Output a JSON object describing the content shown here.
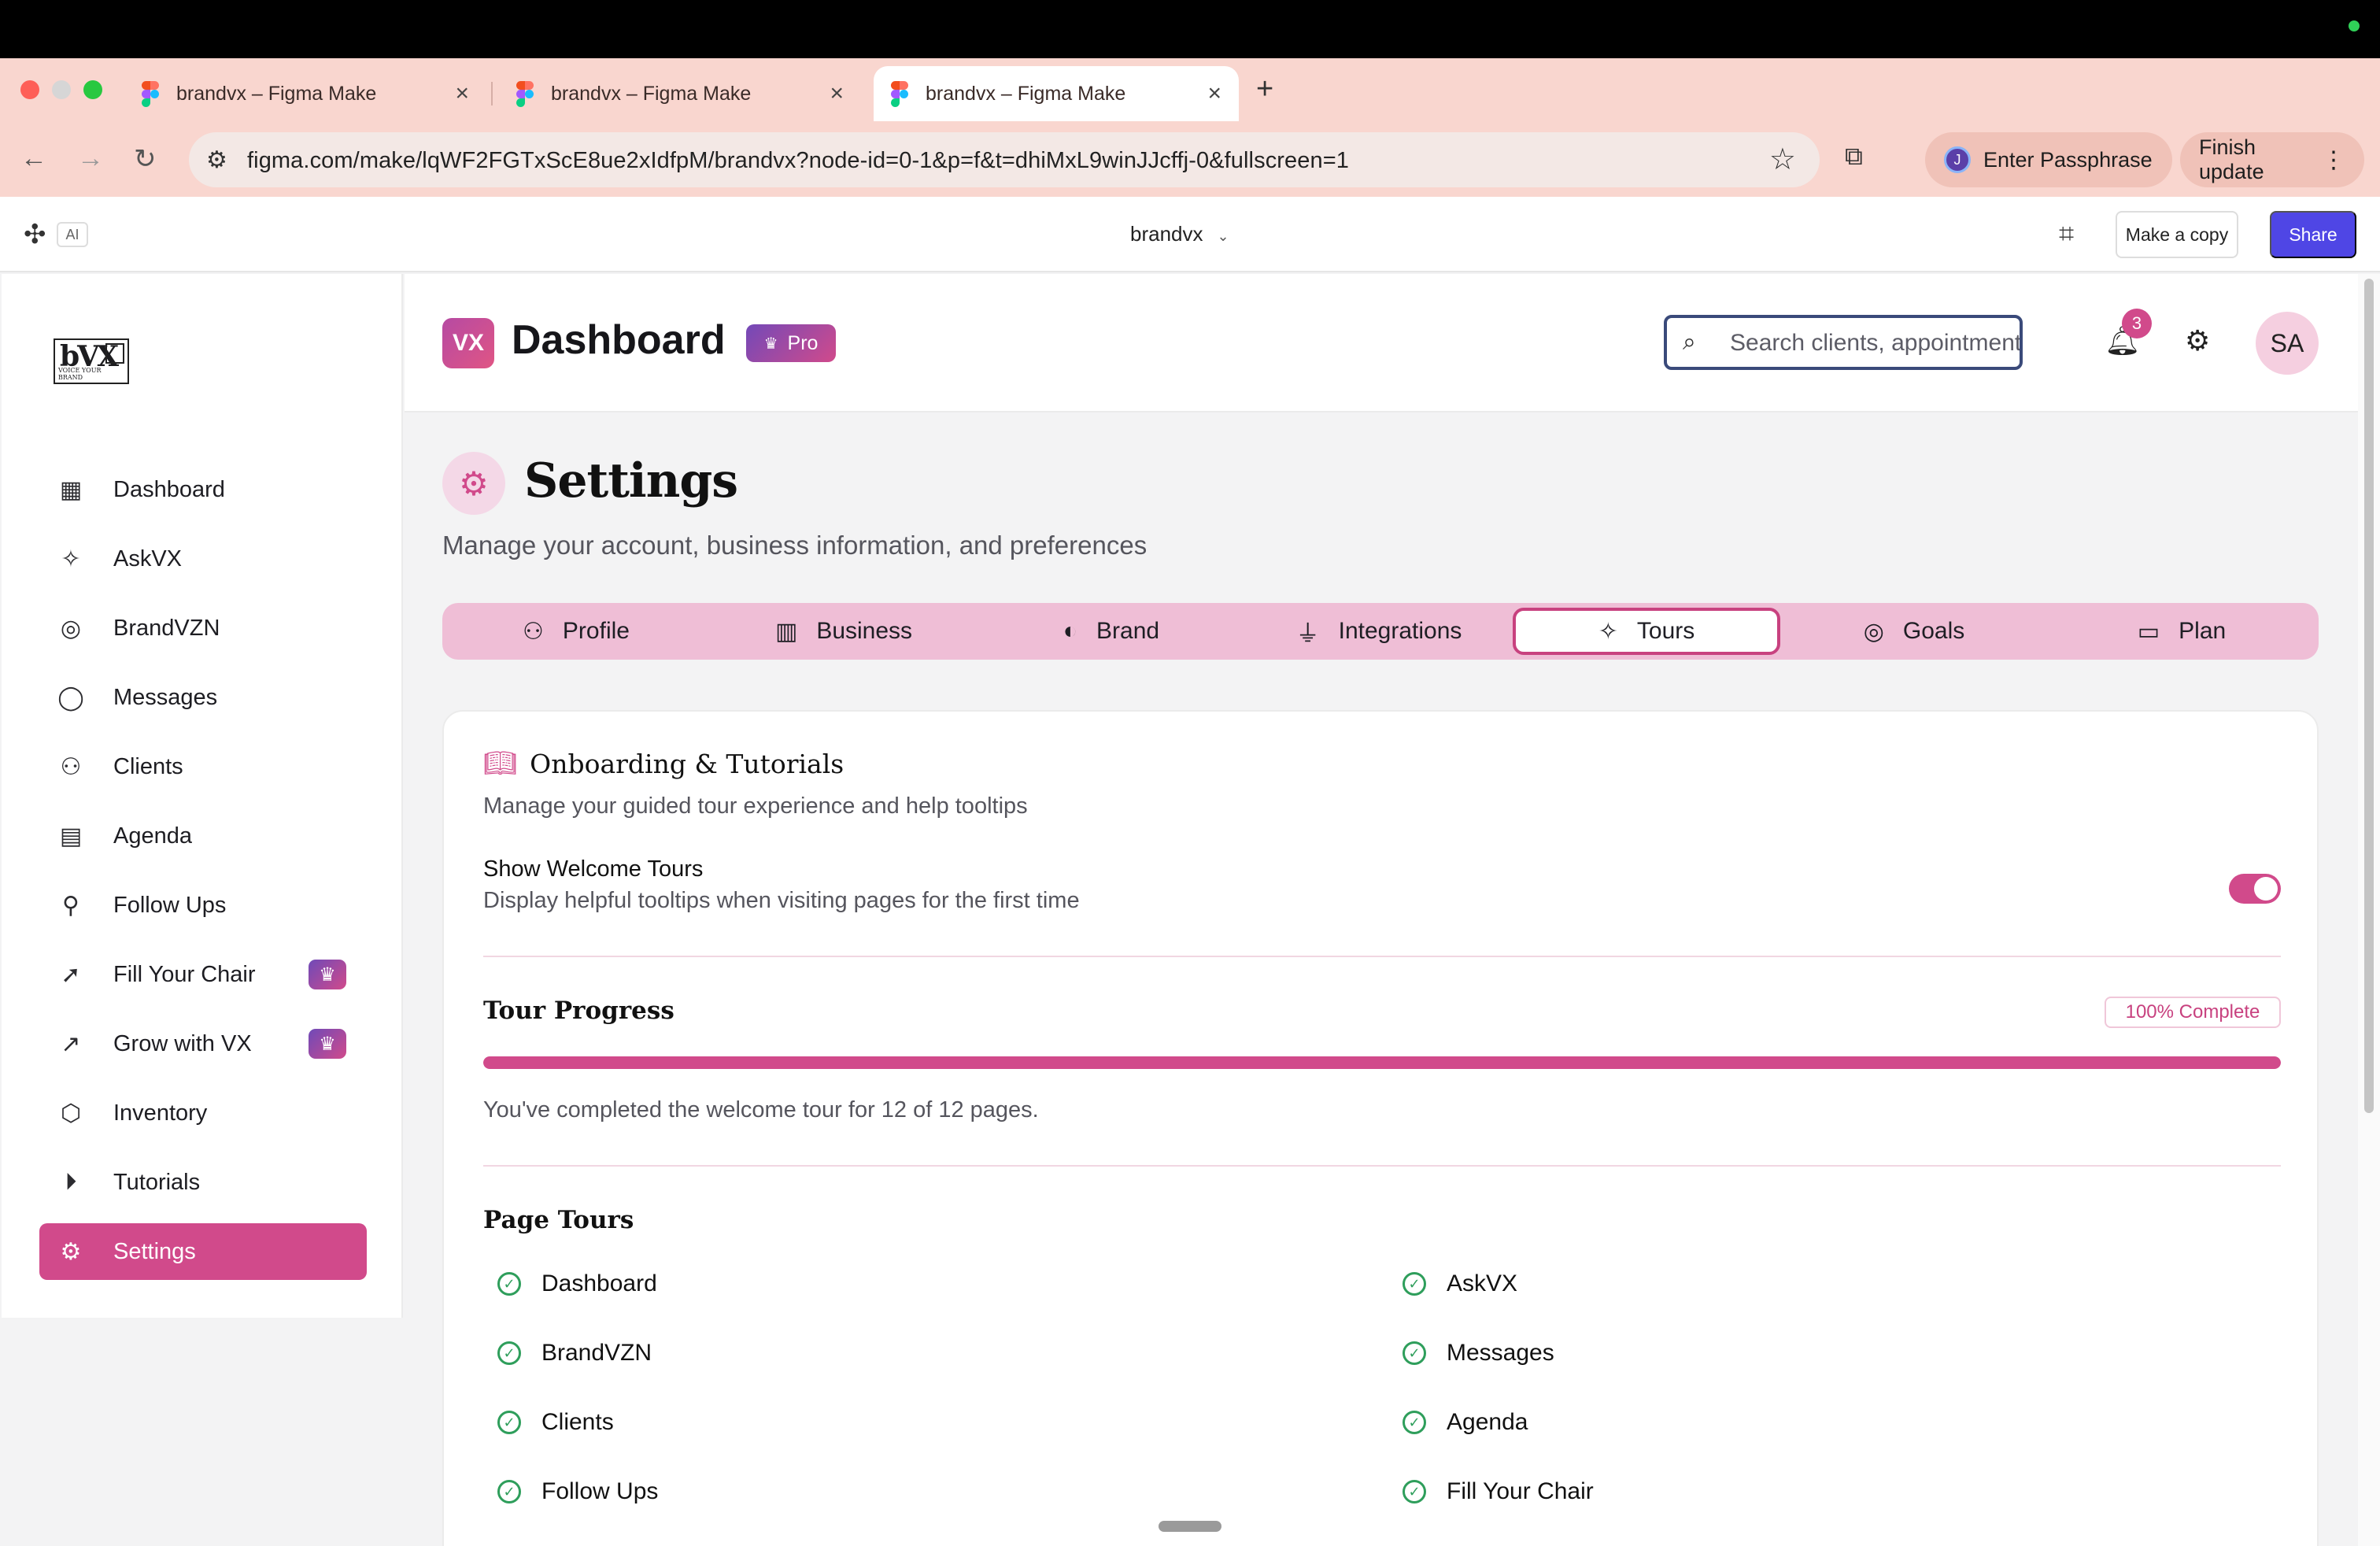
{
  "browser": {
    "tabs": [
      {
        "title": "brandvx – Figma Make"
      },
      {
        "title": "brandvx – Figma Make"
      },
      {
        "title": "brandvx – Figma Make"
      }
    ],
    "url": "figma.com/make/lqWF2FGTxScE8ue2xIdfpM/brandvx?node-id=0-1&p=f&t=dhiMxL9winJJcffj-0&fullscreen=1",
    "profile_initial": "J",
    "passphrase_label": "Enter Passphrase",
    "update_label": "Finish update"
  },
  "figma": {
    "ai_label": "AI",
    "project_name": "brandvx",
    "make_copy_label": "Make a copy",
    "share_label": "Share"
  },
  "sidebar": {
    "items": [
      {
        "label": "Dashboard",
        "icon": "dashboard-grid-icon"
      },
      {
        "label": "AskVX",
        "icon": "sparkles-icon"
      },
      {
        "label": "BrandVZN",
        "icon": "target-icon"
      },
      {
        "label": "Messages",
        "icon": "message-bubble-icon"
      },
      {
        "label": "Clients",
        "icon": "users-icon"
      },
      {
        "label": "Agenda",
        "icon": "clipboard-icon"
      },
      {
        "label": "Follow Ups",
        "icon": "user-check-icon"
      },
      {
        "label": "Fill Your Chair",
        "icon": "cursor-icon",
        "pro": true
      },
      {
        "label": "Grow with VX",
        "icon": "trending-up-icon",
        "pro": true
      },
      {
        "label": "Inventory",
        "icon": "box-icon"
      },
      {
        "label": "Tutorials",
        "icon": "play-circle-icon"
      },
      {
        "label": "Settings",
        "icon": "gear-icon",
        "active": true
      }
    ]
  },
  "header": {
    "badge": "VX",
    "title": "Dashboard",
    "pro_label": "Pro",
    "search_placeholder": "Search clients, appointments...",
    "notification_count": "3",
    "avatar_initials": "SA"
  },
  "page": {
    "title": "Settings",
    "subtitle": "Manage your account, business information, and preferences"
  },
  "tabs": [
    {
      "label": "Profile",
      "icon": "user-icon"
    },
    {
      "label": "Business",
      "icon": "building-icon"
    },
    {
      "label": "Brand",
      "icon": "palette-icon"
    },
    {
      "label": "Integrations",
      "icon": "plug-icon"
    },
    {
      "label": "Tours",
      "icon": "sparkles-icon",
      "active": true
    },
    {
      "label": "Goals",
      "icon": "target-icon"
    },
    {
      "label": "Plan",
      "icon": "credit-card-icon"
    }
  ],
  "onboarding": {
    "title": "Onboarding & Tutorials",
    "subtitle": "Manage your guided tour experience and help tooltips",
    "welcome_title": "Show Welcome Tours",
    "welcome_desc": "Display helpful tooltips when visiting pages for the first time",
    "welcome_enabled": true,
    "progress_title": "Tour Progress",
    "progress_badge": "100% Complete",
    "progress_percent": 100,
    "progress_text": "You've completed the welcome tour for 12 of 12 pages.",
    "page_tours_title": "Page Tours",
    "page_tours": [
      "Dashboard",
      "AskVX",
      "BrandVZN",
      "Messages",
      "Clients",
      "Agenda",
      "Follow Ups",
      "Fill Your Chair"
    ]
  },
  "colors": {
    "accent": "#d14a8b",
    "tabs_bg": "#efbed6",
    "share_button": "#4f46e5",
    "check_green": "#2e9e5b"
  }
}
